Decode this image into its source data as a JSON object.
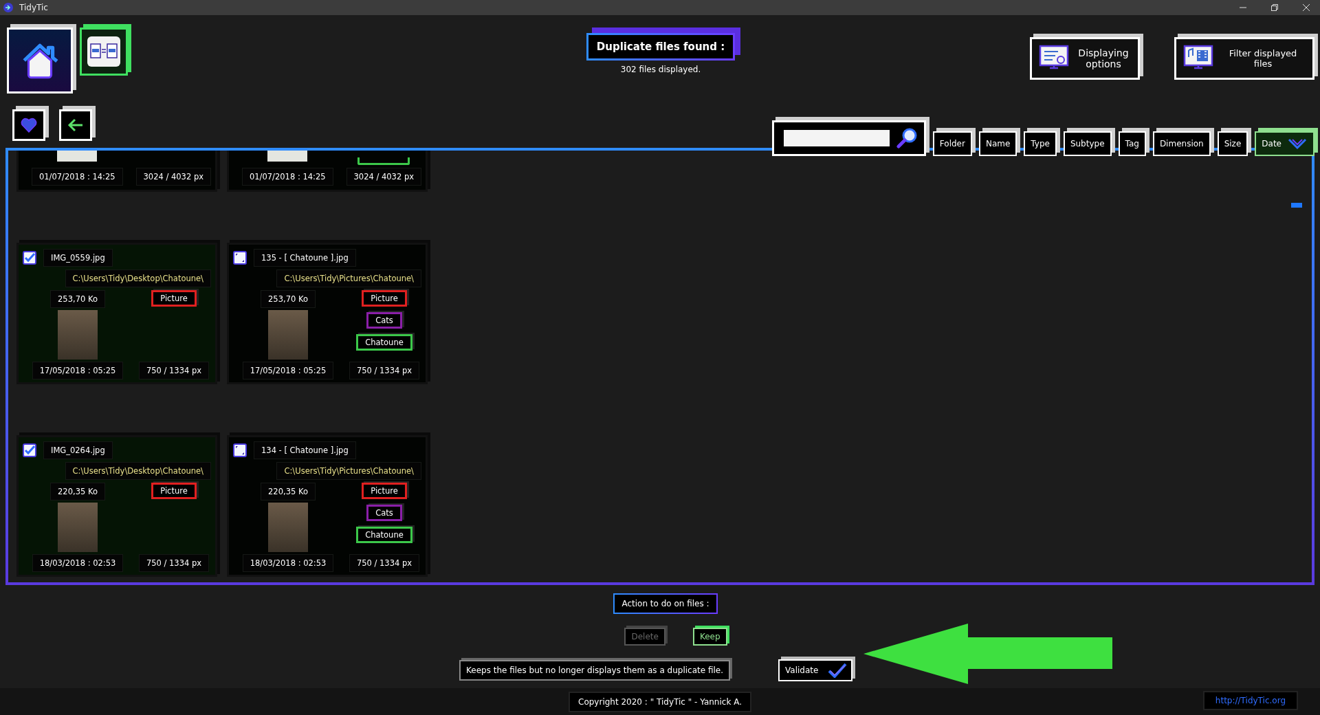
{
  "window": {
    "title": "TidyTic"
  },
  "nav_buttons": [
    {
      "kind": "home",
      "selected": false
    },
    {
      "kind": "duplicates",
      "selected": true
    },
    {
      "kind": "favorites",
      "selected": false
    },
    {
      "kind": "back",
      "selected": false
    }
  ],
  "header": {
    "title": "Duplicate files found :",
    "subtitle": "302 files displayed."
  },
  "option_buttons": [
    {
      "kind": "display",
      "label": "Displaying options"
    },
    {
      "kind": "filter",
      "label": "Filter displayed files"
    }
  ],
  "sort_tabs": [
    {
      "label": "Folder",
      "selected": false
    },
    {
      "label": "Name",
      "selected": false
    },
    {
      "label": "Type",
      "selected": false
    },
    {
      "label": "Subtype",
      "selected": false
    },
    {
      "label": "Tag",
      "selected": false
    },
    {
      "label": "Dimension",
      "selected": false
    },
    {
      "label": "Size",
      "selected": false
    },
    {
      "label": "Date",
      "selected": true
    }
  ],
  "cut_off_group": {
    "files": [
      {
        "date": "01/07/2018 : 14:25",
        "dimensions": "3024 / 4032 px"
      },
      {
        "date": "01/07/2018 : 14:25",
        "dimensions": "3024 / 4032 px",
        "tags": [
          {
            "color": "#3cc84a"
          }
        ]
      }
    ]
  },
  "groups": [
    {
      "files": [
        {
          "checked": true,
          "name": "IMG_0559.jpg",
          "path": "C:\\Users\\Tidy\\Desktop\\Chatoune\\",
          "size": "253,70 Ko",
          "date": "17/05/2018 : 05:25",
          "dimensions": "750 / 1334 px",
          "tags": [
            {
              "label": "Picture",
              "color": "#e02020"
            }
          ]
        },
        {
          "checked": false,
          "name": "135 - [ Chatoune ].jpg",
          "path": "C:\\Users\\Tidy\\Pictures\\Chatoune\\",
          "size": "253,70 Ko",
          "date": "17/05/2018 : 05:25",
          "dimensions": "750 / 1334 px",
          "tags": [
            {
              "label": "Picture",
              "color": "#e02020"
            },
            {
              "label": "Cats",
              "color": "#8a1fa8"
            },
            {
              "label": "Chatoune",
              "color": "#3cc84a"
            }
          ]
        }
      ]
    },
    {
      "files": [
        {
          "checked": true,
          "name": "IMG_0264.jpg",
          "path": "C:\\Users\\Tidy\\Desktop\\Chatoune\\",
          "size": "220,35 Ko",
          "date": "18/03/2018 : 02:53",
          "dimensions": "750 / 1334 px",
          "tags": [
            {
              "label": "Picture",
              "color": "#e02020"
            }
          ]
        },
        {
          "checked": false,
          "name": "134 - [ Chatoune ].jpg",
          "path": "C:\\Users\\Tidy\\Pictures\\Chatoune\\",
          "size": "220,35 Ko",
          "date": "18/03/2018 : 02:53",
          "dimensions": "750 / 1334 px",
          "tags": [
            {
              "label": "Picture",
              "color": "#e02020"
            },
            {
              "label": "Cats",
              "color": "#8a1fa8"
            },
            {
              "label": "Chatoune",
              "color": "#3cc84a"
            }
          ]
        }
      ]
    }
  ],
  "action_title": "Action to do on files :",
  "actions": [
    {
      "label": "Delete",
      "selected": false
    },
    {
      "label": "Keep",
      "selected": true
    }
  ],
  "action_description": "Keeps the files but no longer displays them as a duplicate file.",
  "validate_button": "Validate",
  "footer": {
    "copyright": "Copyright 2020 : \" TidyTic \" - Yannick A.",
    "link": "http://TidyTic.org"
  }
}
